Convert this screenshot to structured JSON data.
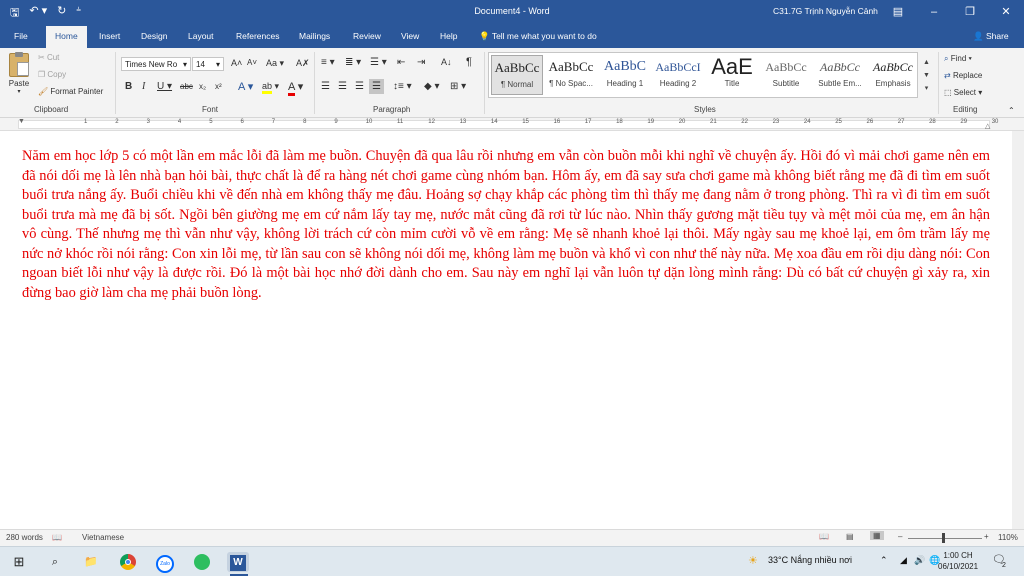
{
  "window": {
    "title": "Document4  -  Word",
    "user": "C31.7G Trịnh Nguyễn Cảnh",
    "share": "Share",
    "tell_me": "Tell me what you want to do"
  },
  "colors": {
    "accent": "#2b579a",
    "body_text": "#e60000",
    "highlight": "#ffff00"
  },
  "tabs": [
    "File",
    "Home",
    "Insert",
    "Design",
    "Layout",
    "References",
    "Mailings",
    "Review",
    "View",
    "Help"
  ],
  "active_tab": "Home",
  "clipboard": {
    "paste": "Paste",
    "cut": "Cut",
    "copy": "Copy",
    "format_painter": "Format Painter",
    "label": "Clipboard"
  },
  "font": {
    "name": "Times New Ro",
    "size": "14",
    "label": "Font"
  },
  "paragraph": {
    "label": "Paragraph"
  },
  "styles": {
    "label": "Styles",
    "items": [
      {
        "preview": "AaBbCc",
        "name": "¶ Normal"
      },
      {
        "preview": "AaBbCc",
        "name": "¶ No Spac..."
      },
      {
        "preview": "AaBbC",
        "name": "Heading 1"
      },
      {
        "preview": "AaBbCcI",
        "name": "Heading 2"
      },
      {
        "preview": "AaE",
        "name": "Title"
      },
      {
        "preview": "AaBbCc",
        "name": "Subtitle"
      },
      {
        "preview": "AaBbCc",
        "name": "Subtle Em..."
      },
      {
        "preview": "AaBbCc",
        "name": "Emphasis"
      }
    ]
  },
  "editing": {
    "find": "Find",
    "replace": "Replace",
    "select": "Select",
    "label": "Editing"
  },
  "ruler_numbers": [
    "1",
    "2",
    "3",
    "4",
    "5",
    "6",
    "7",
    "8",
    "9",
    "10",
    "11",
    "12",
    "13",
    "14",
    "15",
    "16",
    "17",
    "18",
    "19",
    "20",
    "21",
    "22",
    "23",
    "24",
    "25",
    "26",
    "27",
    "28",
    "29",
    "30"
  ],
  "document": {
    "text": "Năm em học lớp 5 có một lần em mắc lỗi đã làm mẹ buồn. Chuyện đã qua lâu rồi nhưng em vẫn còn buồn mỗi khi nghĩ về chuyện ấy. Hồi đó vì mải chơi game nên em đã nói dối mẹ là lên nhà bạn hỏi bài, thực chất là để ra hàng nét chơi game cùng nhóm bạn. Hôm ấy, em đã say sưa chơi game mà không biết rằng mẹ đã đi tìm em suốt buổi trưa nắng ấy. Buổi chiều khi về đến nhà em không thấy mẹ đâu. Hoảng sợ chạy khắp các phòng tìm thì thấy mẹ đang nằm ở trong phòng. Thì ra vì đi tìm em suốt buổi trưa mà mẹ đã bị sốt. Ngồi bên giường mẹ em cứ nắm lấy tay mẹ, nước mắt cũng đã rơi từ lúc nào. Nhìn thấy gương mặt tiều tụy và mệt mỏi của mẹ, em ân hận vô cùng. Thế nhưng mẹ thì vẫn như vậy, không lời trách cứ còn mỉm cười vỗ về em rằng: Mẹ sẽ nhanh khoẻ lại thôi. Mấy ngày sau mẹ khoẻ lại, em ôm trầm lấy mẹ nức nở khóc rồi nói rằng: Con xin lỗi mẹ, từ lần sau con sẽ không nói dối mẹ, không làm mẹ buồn và khổ vì con như thế này nữa. Mẹ xoa đầu em rồi dịu dàng nói: Con ngoan biết lỗi như vậy là được rồi. Đó là một bài học nhớ đời dành cho em. Sau này em nghĩ lại vẫn luôn tự dặn lòng mình rằng: Dù có bất cứ chuyện gì xảy ra, xin đừng bao giờ làm cha mẹ phải buồn lòng."
  },
  "status": {
    "words": "280 words",
    "language": "Vietnamese",
    "zoom": "110%"
  },
  "tray": {
    "weather": "33°C  Nắng nhiều nơi",
    "time": "1:00 CH",
    "date": "06/10/2021",
    "notifications": "2"
  }
}
